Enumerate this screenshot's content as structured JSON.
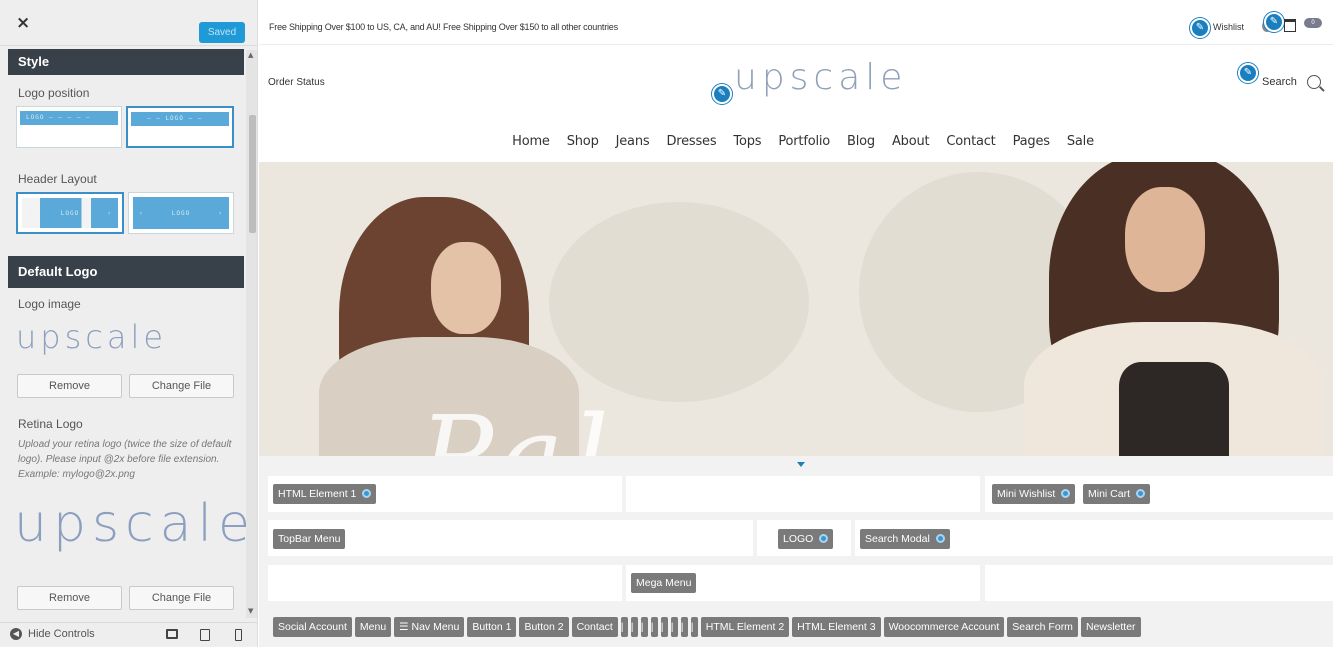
{
  "sidebar": {
    "close_label": "×",
    "saved_label": "Saved",
    "style_heading": "Style",
    "logo_position_label": "Logo position",
    "logo_position_options": [
      "LOGO — — — — —",
      "— — LOGO — —"
    ],
    "header_layout_label": "Header Layout",
    "header_layout_options": [
      [
        "‹",
        "LOGO",
        "›"
      ],
      [
        "‹",
        "LOGO",
        "›"
      ]
    ],
    "default_logo_heading": "Default Logo",
    "logo_image_label": "Logo image",
    "logo_preview_text": "upscale",
    "remove_label": "Remove",
    "change_file_label": "Change File",
    "retina_logo_label": "Retina Logo",
    "retina_description": "Upload your retina logo (twice the size of default logo). Please input @2x before file extension. Example: mylogo@2x.png",
    "retina_preview_text": "upscale",
    "hide_controls_label": "Hide Controls",
    "device_icons": [
      "desktop-icon",
      "tablet-icon",
      "mobile-icon"
    ]
  },
  "preview": {
    "announcement": "Free Shipping Over $100 to US, CA, and AU! Free Shipping Over $150 to all other countries",
    "wishlist_label": "Wishlist",
    "cart_count": "0",
    "order_status": "Order Status",
    "logo_text": "upscale",
    "search_label": "Search",
    "nav": [
      "Home",
      "Shop",
      "Jeans",
      "Dresses",
      "Tops",
      "Portfolio",
      "Blog",
      "About",
      "Contact",
      "Pages",
      "Sale"
    ],
    "hero_script": "Pal"
  },
  "builder": {
    "row1": {
      "left": "HTML Element 1",
      "right": [
        "Mini Wishlist",
        "Mini Cart"
      ]
    },
    "row2": {
      "left": "TopBar Menu",
      "center": "LOGO",
      "right": "Search Modal"
    },
    "row3": {
      "center": "Mega Menu"
    },
    "palette": [
      "Social Account",
      "Menu",
      "☰ Nav Menu",
      "Button 1",
      "Button 2",
      "Contact",
      "|",
      "|",
      "|",
      "|",
      "|",
      "|",
      "|",
      "|",
      "HTML Element 2",
      "HTML Element 3",
      "Woocommerce Account",
      "Search Form",
      "Newsletter"
    ]
  },
  "colors": {
    "accent": "#1f9ad6",
    "section_header": "#38414a",
    "chip": "#7a7a7a",
    "logo": "#8fa0b8"
  }
}
